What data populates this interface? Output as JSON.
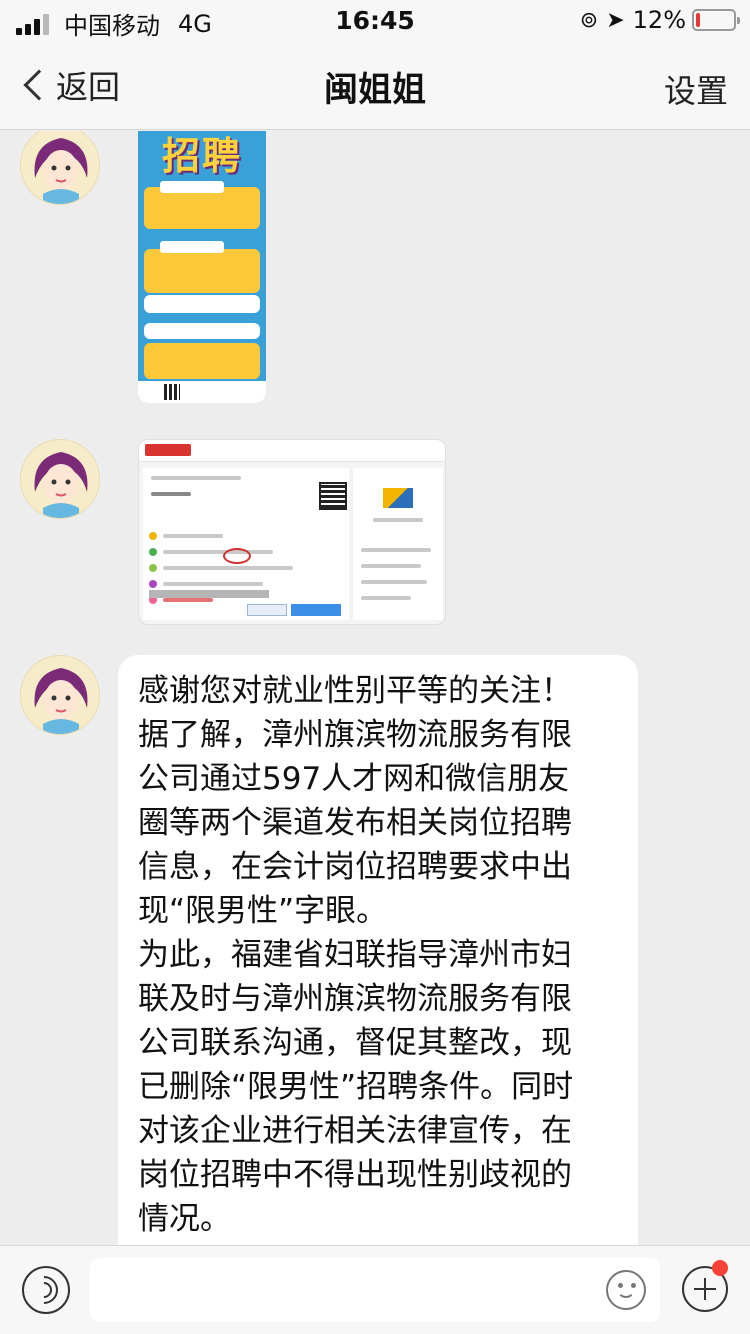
{
  "status_bar": {
    "carrier": "中国移动",
    "network": "4G",
    "time": "16:45",
    "battery_text": "12%",
    "battery_level": 0.12,
    "battery_color": "#e53935"
  },
  "nav": {
    "back_label": "返回",
    "title": "闽姐姐",
    "settings_label": "设置"
  },
  "messages": [
    {
      "type": "image",
      "content": "recruitment-poster",
      "poster_title": "招聘"
    },
    {
      "type": "image",
      "content": "job-listing-screenshot"
    },
    {
      "type": "text",
      "lines": [
        "感谢您对就业性别平等的关注！",
        "据了解，漳州旗滨物流服务有限",
        "公司通过597人才网和微信朋友",
        "圈等两个渠道发布相关岗位招聘",
        "信息，在会计岗位招聘要求中出",
        "现“限男性”字眼。",
        "为此，福建省妇联指导漳州市妇",
        "联及时与漳州旗滨物流服务有限",
        "公司联系沟通，督促其整改，现",
        "已删除“限男性”招聘条件。同时",
        "对该企业进行相关法律宣传，在",
        "岗位招聘中不得出现性别歧视的",
        "情况。"
      ]
    }
  ],
  "input_bar": {
    "voice_icon": "voice-icon",
    "emoji_icon": "emoji-icon",
    "plus_icon": "plus-icon",
    "plus_badge_color": "#f44336"
  }
}
